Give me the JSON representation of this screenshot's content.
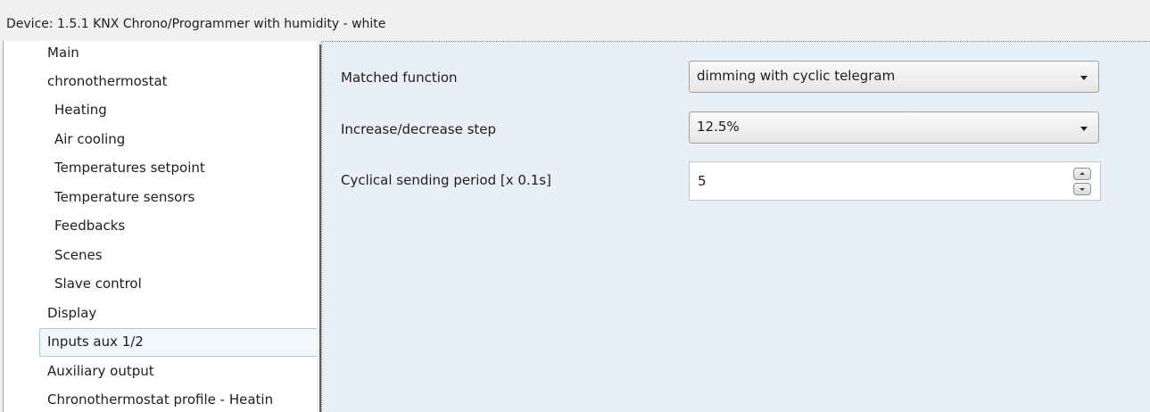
{
  "title": "Device: 1.5.1  KNX Chrono/Programmer with humidity - white",
  "sidebar": {
    "items": [
      {
        "label": "Main",
        "level": 0
      },
      {
        "label": "chronothermostat",
        "level": 0
      },
      {
        "label": "Heating",
        "level": 1
      },
      {
        "label": "Air cooling",
        "level": 1
      },
      {
        "label": "Temperatures setpoint",
        "level": 1
      },
      {
        "label": "Temperature sensors",
        "level": 1
      },
      {
        "label": "Feedbacks",
        "level": 1
      },
      {
        "label": "Scenes",
        "level": 1
      },
      {
        "label": "Slave control",
        "level": 1
      },
      {
        "label": "Display",
        "level": 0
      },
      {
        "label": "Inputs aux 1/2",
        "level": 0,
        "selected": true
      },
      {
        "label": "Auxiliary output",
        "level": 0
      },
      {
        "label": "Chronothermostat profile - Heatin",
        "level": 0
      }
    ]
  },
  "params": {
    "matched_function": {
      "label": "Matched function",
      "value": "dimming with cyclic telegram"
    },
    "step": {
      "label": "Increase/decrease step",
      "value": "12.5%"
    },
    "period": {
      "label": "Cyclical sending period [x 0.1s]",
      "value": "5"
    }
  },
  "colors": {
    "content_bg": "#e8eff6",
    "selection_border": "#a3c8ee",
    "selection_bg": "#f3f8fd"
  }
}
